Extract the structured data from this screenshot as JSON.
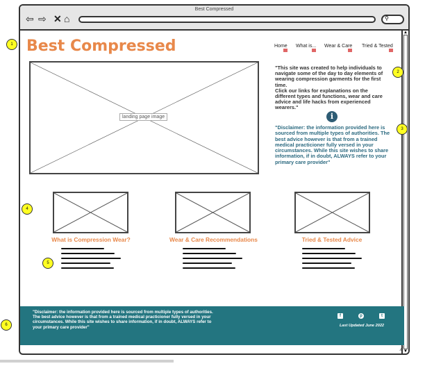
{
  "browser": {
    "title": "Best Compressed",
    "nav_icons": [
      "back-icon",
      "forward-icon",
      "close-icon",
      "home-icon"
    ],
    "search_icon": "search-icon"
  },
  "site": {
    "logo": "Best Compressed",
    "accent_color": "#e8884a",
    "nav": [
      {
        "label": "Home"
      },
      {
        "label": "What is..."
      },
      {
        "label": "Wear & Care"
      },
      {
        "label": "Tried & Tested"
      }
    ],
    "hero_caption": "landing page image",
    "intro": "\"This site was created to help individuals to navigate some of the day to day elements of wearing compression garments for the first time.\nClick our links for explanations on the different types and functions, wear and care advice and life hacks from experienced wearers.\"",
    "disclaimer": "\"Disclaimer: the information provided here is sourced from multiple types of authorities. The best advice however is that from a trained medical practicioner fully versed in your circumstances.  While this site wishes to share information, if in doubt, ALWAYS refer to your primary care provider\"",
    "cards": [
      {
        "title": "What is Compression Wear?"
      },
      {
        "title": "Wear & Care Recommendations"
      },
      {
        "title": "Tried & Tested Advice"
      }
    ]
  },
  "footer": {
    "color": "#237580",
    "disclaimer": "\"Disclaimer: the information provided here is sourced from multiple types of authorities. The best advice however is that from a trained medical practicioner fully versed in your circumstances.  While this site wishes to share information, if in doubt, ALWAYS refer to your primary care provider\"",
    "social": [
      "f",
      "p",
      "t"
    ],
    "social_icons": [
      "facebook-icon",
      "pinterest-icon",
      "twitter-icon"
    ],
    "last_updated": "Last Updated June 2022"
  },
  "markers": [
    "1",
    "2",
    "3",
    "4",
    "5",
    "6"
  ]
}
